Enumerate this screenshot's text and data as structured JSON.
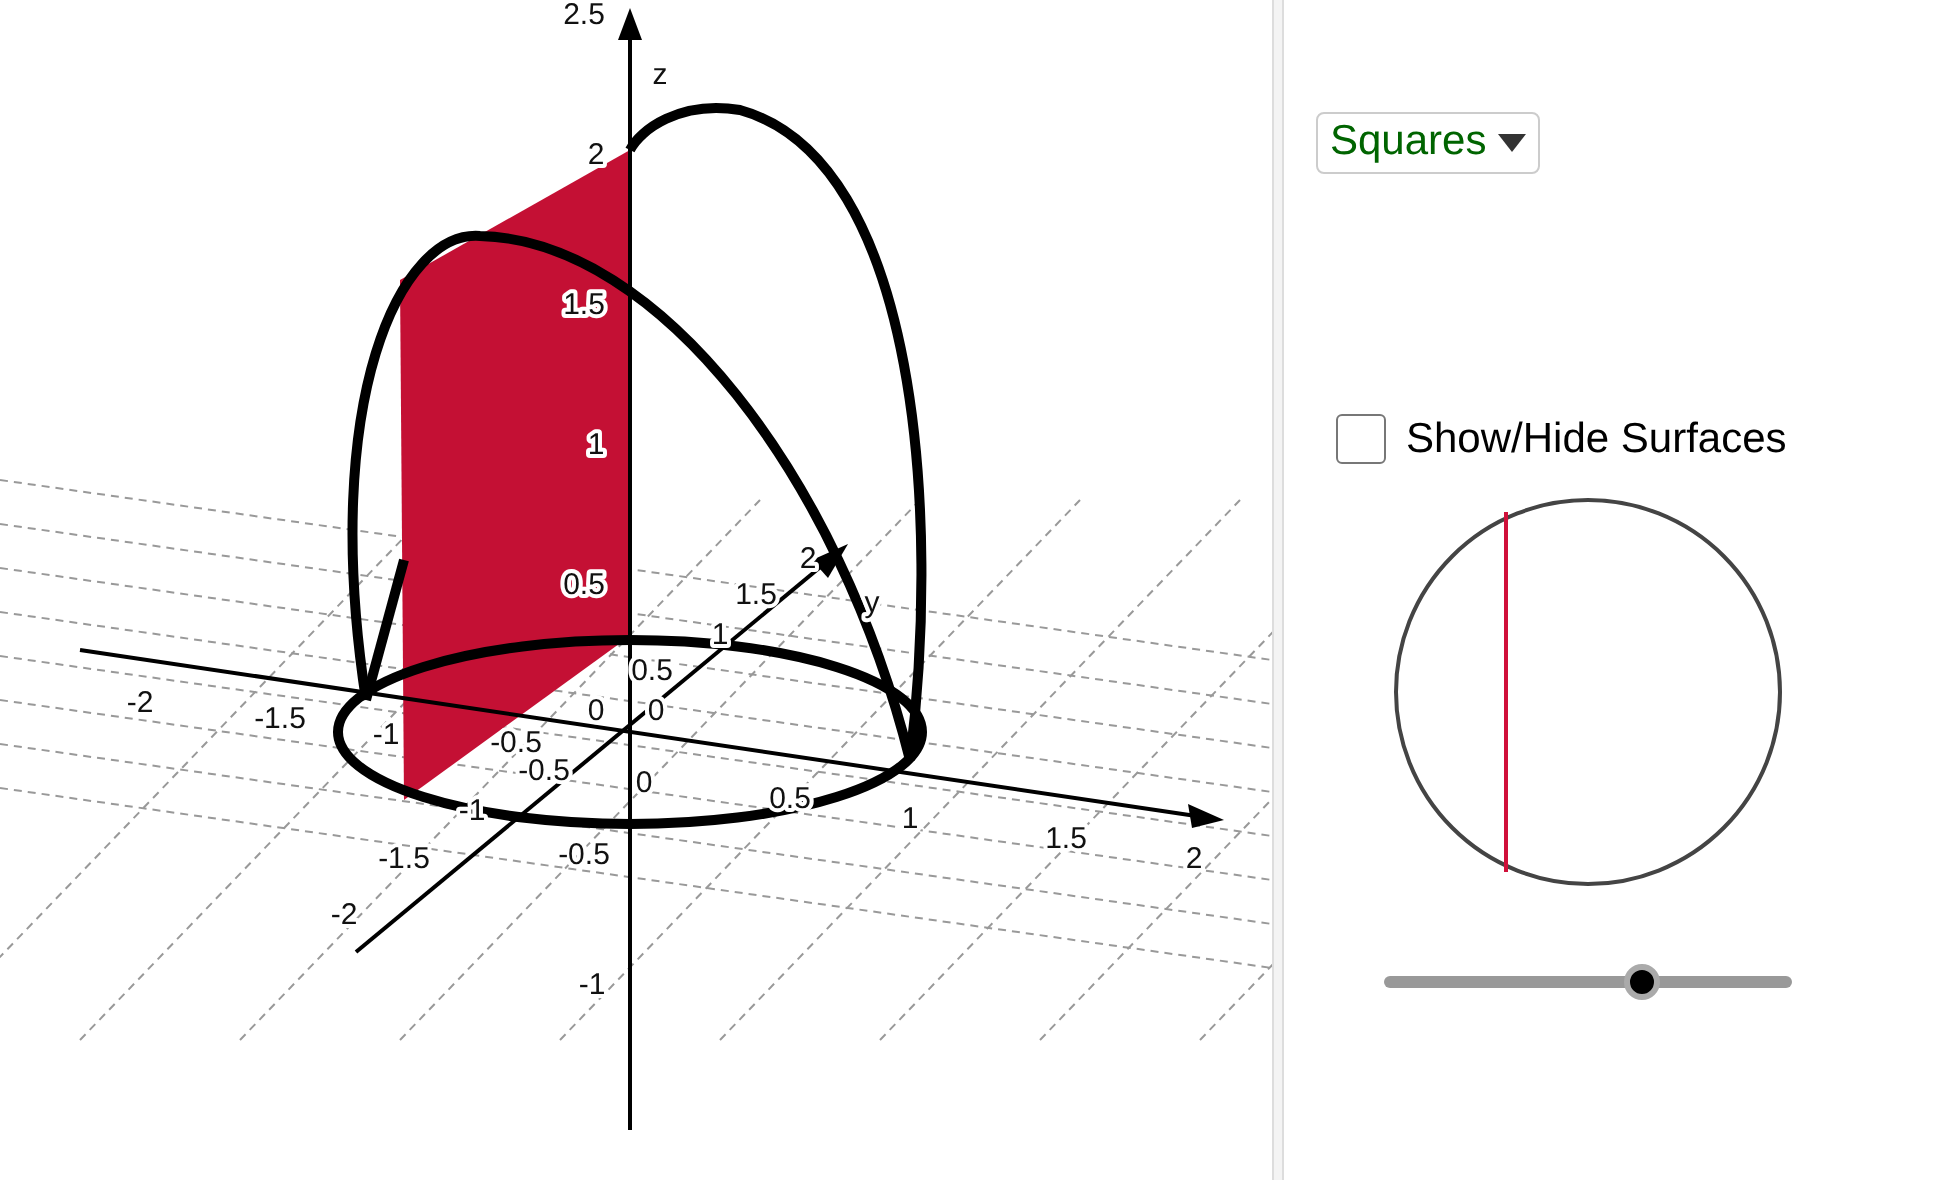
{
  "graph_3d": {
    "x_ticks": [
      "-2",
      "-1.5",
      "-1",
      "-0.5",
      "0",
      "0.5",
      "1",
      "1.5",
      "2"
    ],
    "y_ticks": [
      "-2",
      "-1.5",
      "-1",
      "-0.5",
      "0",
      "0.5",
      "1",
      "1.5",
      "2"
    ],
    "z_ticks": [
      "2.5",
      "2",
      "1.5",
      "1",
      "0.5",
      "0",
      "-0.5",
      "-1"
    ],
    "axis_names": [
      "z",
      "y"
    ]
  },
  "dropdown": {
    "value": "Squares"
  },
  "checkbox": {
    "label": "Show/Hide Surfaces",
    "checked": false
  },
  "slider": {
    "level": 0.63
  }
}
